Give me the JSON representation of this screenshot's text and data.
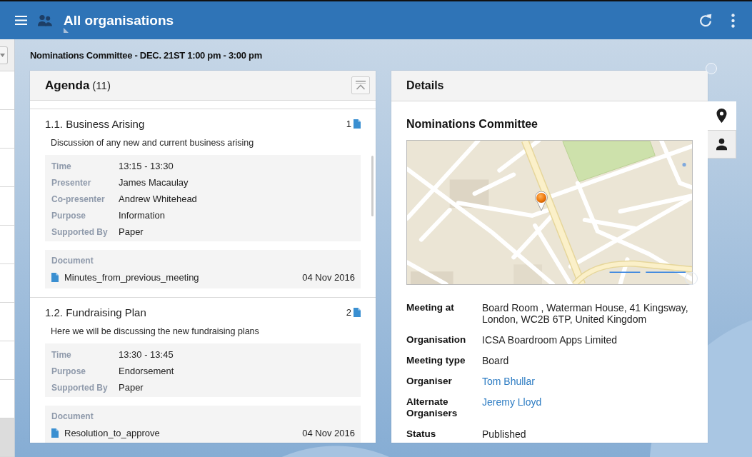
{
  "app_bar": {
    "title": "All organisations"
  },
  "side_list": {
    "rows": [
      {
        "selected": false
      },
      {
        "selected": false
      },
      {
        "selected": false
      },
      {
        "selected": false
      },
      {
        "selected": false
      },
      {
        "selected": false
      },
      {
        "selected": false
      },
      {
        "selected": false
      },
      {
        "selected": false
      },
      {
        "selected": true
      }
    ]
  },
  "meeting_heading": "Nominations Committee - DEC. 21ST 1:00 pm - 3:00 pm",
  "agenda": {
    "title": "Agenda",
    "count": "(11)",
    "items": [
      {
        "title": "1.1. Business Arising",
        "document_count": "1",
        "description": "Discussion of any new and current business arising",
        "fields": [
          {
            "label": "Time",
            "value": "13:15 - 13:30"
          },
          {
            "label": "Presenter",
            "value": "James Macaulay"
          },
          {
            "label": "Co-presenter",
            "value": "Andrew Whitehead"
          },
          {
            "label": "Purpose",
            "value": "Information"
          },
          {
            "label": "Supported By",
            "value": "Paper"
          }
        ],
        "documents_label": "Document",
        "documents": [
          {
            "name": "Minutes_from_previous_meeting",
            "date": "04 Nov 2016"
          }
        ]
      },
      {
        "title": "1.2. Fundraising Plan",
        "document_count": "2",
        "description": "Here we will be discussing the new fundraising plans",
        "fields": [
          {
            "label": "Time",
            "value": "13:30 - 13:45"
          },
          {
            "label": "Purpose",
            "value": "Endorsement"
          },
          {
            "label": "Supported By",
            "value": "Paper"
          }
        ],
        "documents_label": "Document",
        "documents": [
          {
            "name": "Resolution_to_approve",
            "date": "04 Nov 2016"
          }
        ]
      }
    ]
  },
  "details": {
    "title": "Details",
    "tabs": [
      {
        "kind": "map",
        "selected": true
      },
      {
        "kind": "contact",
        "selected": false
      }
    ],
    "meeting_name": "Nominations Committee",
    "fields": [
      {
        "label": "Meeting at",
        "value": "Board Room , Waterman House, 41 Kingsway, London, WC2B 6TP, United Kingdom",
        "kind": "text"
      },
      {
        "label": "Organisation",
        "value": "ICSA Boardroom Apps Limited",
        "kind": "text"
      },
      {
        "label": "Meeting type",
        "value": "Board",
        "kind": "text"
      },
      {
        "label": "Organiser",
        "value": "Tom Bhullar",
        "kind": "link"
      },
      {
        "label": "Alternate Organisers",
        "value": "Jeremy Lloyd",
        "kind": "link"
      },
      {
        "label": "Status",
        "value": "Published",
        "kind": "text"
      }
    ]
  }
}
